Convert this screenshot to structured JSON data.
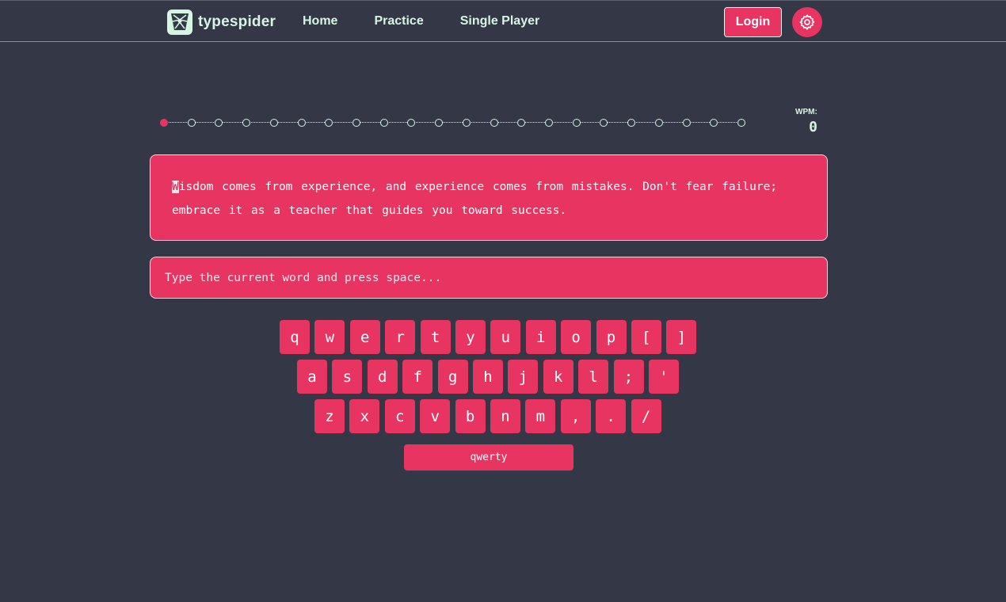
{
  "header": {
    "brand": "typespider",
    "nav": [
      "Home",
      "Practice",
      "Single Player"
    ],
    "login_label": "Login",
    "settings_icon": "gear-icon"
  },
  "progress": {
    "total_words": 22,
    "current_index": 0,
    "wpm_label": "WPM:",
    "wpm_value": "0"
  },
  "passage": {
    "cursor_char": "W",
    "rest": "isdom comes from experience, and experience comes from mistakes. Don't fear failure; embrace it as a teacher that guides you toward success."
  },
  "input": {
    "value": "",
    "placeholder": "Type the current word and press space..."
  },
  "keyboard": {
    "rows": [
      [
        "q",
        "w",
        "e",
        "r",
        "t",
        "y",
        "u",
        "i",
        "o",
        "p",
        "[",
        "]"
      ],
      [
        "a",
        "s",
        "d",
        "f",
        "g",
        "h",
        "j",
        "k",
        "l",
        ";",
        "'"
      ],
      [
        "z",
        "x",
        "c",
        "v",
        "b",
        "n",
        "m",
        ",",
        ".",
        "/"
      ]
    ],
    "layout_label": "qwerty"
  },
  "colors": {
    "accent": "#e83461",
    "background": "#343746",
    "text_light": "#d6f5e3"
  }
}
